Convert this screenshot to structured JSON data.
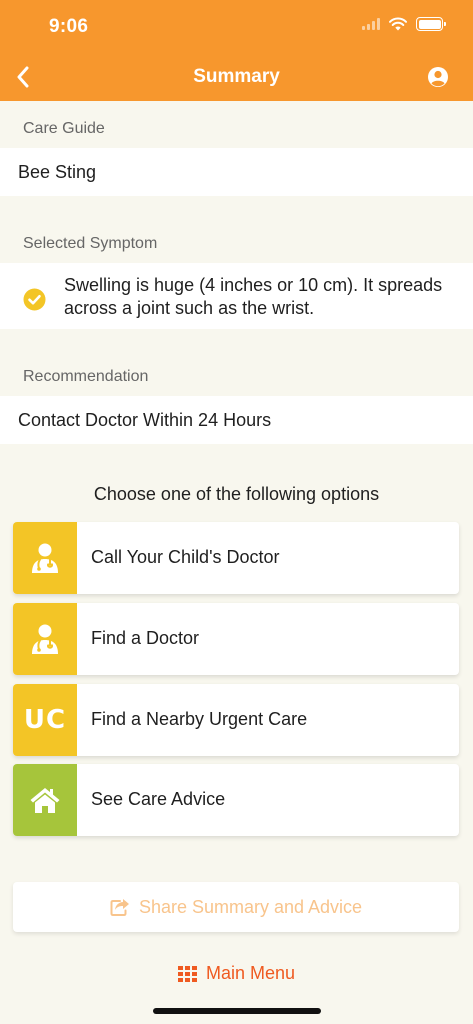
{
  "status_bar": {
    "time": "9:06"
  },
  "header": {
    "title": "Summary"
  },
  "care_guide": {
    "label": "Care Guide",
    "value": "Bee Sting"
  },
  "selected_symptom": {
    "label": "Selected Symptom",
    "text": "Swelling is huge (4 inches or 10 cm). It spreads across a joint such as the wrist."
  },
  "recommendation": {
    "label": "Recommendation",
    "value": "Contact Doctor Within 24 Hours"
  },
  "options": {
    "heading": "Choose one of the following options",
    "items": [
      {
        "label": "Call Your Child's Doctor",
        "icon": "doctor-icon",
        "color": "#f3c526"
      },
      {
        "label": "Find a Doctor",
        "icon": "doctor-icon",
        "color": "#f3c526"
      },
      {
        "label": "Find a Nearby Urgent Care",
        "icon": "urgent-care-icon",
        "badge": "UC",
        "color": "#f3c526"
      },
      {
        "label": "See Care Advice",
        "icon": "home-icon",
        "color": "#a6c53b"
      }
    ]
  },
  "share": {
    "label": "Share Summary and Advice"
  },
  "main_menu": {
    "label": "Main Menu"
  },
  "colors": {
    "header": "#f7972d",
    "accent": "#ef5a20",
    "tile_yellow": "#f3c526",
    "tile_green": "#a6c53b",
    "background": "#f8f7ee"
  }
}
